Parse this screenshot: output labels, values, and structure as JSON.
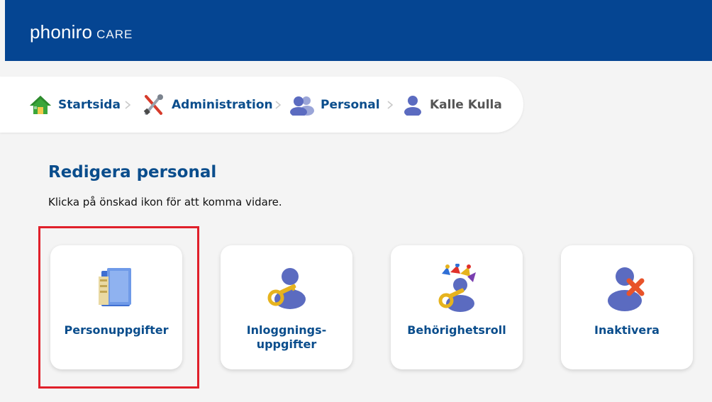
{
  "header": {
    "logo_main": "phoniro",
    "logo_sub": "CARE"
  },
  "breadcrumb": {
    "items": [
      {
        "label": "Startsida",
        "icon": "home-icon"
      },
      {
        "label": "Administration",
        "icon": "tools-icon"
      },
      {
        "label": "Personal",
        "icon": "users-icon"
      },
      {
        "label": "Kalle Kulla",
        "icon": "user-icon"
      }
    ]
  },
  "main": {
    "title": "Redigera personal",
    "subtitle": "Klicka på önskad ikon för att komma vidare.",
    "cards": [
      {
        "label_line1": "Personuppgifter",
        "label_line2": "",
        "icon": "folder-icon"
      },
      {
        "label_line1": "Inloggnings-",
        "label_line2": "uppgifter",
        "icon": "user-key-icon"
      },
      {
        "label_line1": "Behörighetsroll",
        "label_line2": "",
        "icon": "role-key-icon"
      },
      {
        "label_line1": "Inaktivera",
        "label_line2": "",
        "icon": "user-remove-icon"
      }
    ]
  },
  "colors": {
    "header_bg": "#054592",
    "link": "#0a4d8c",
    "highlight": "#e0202a"
  }
}
